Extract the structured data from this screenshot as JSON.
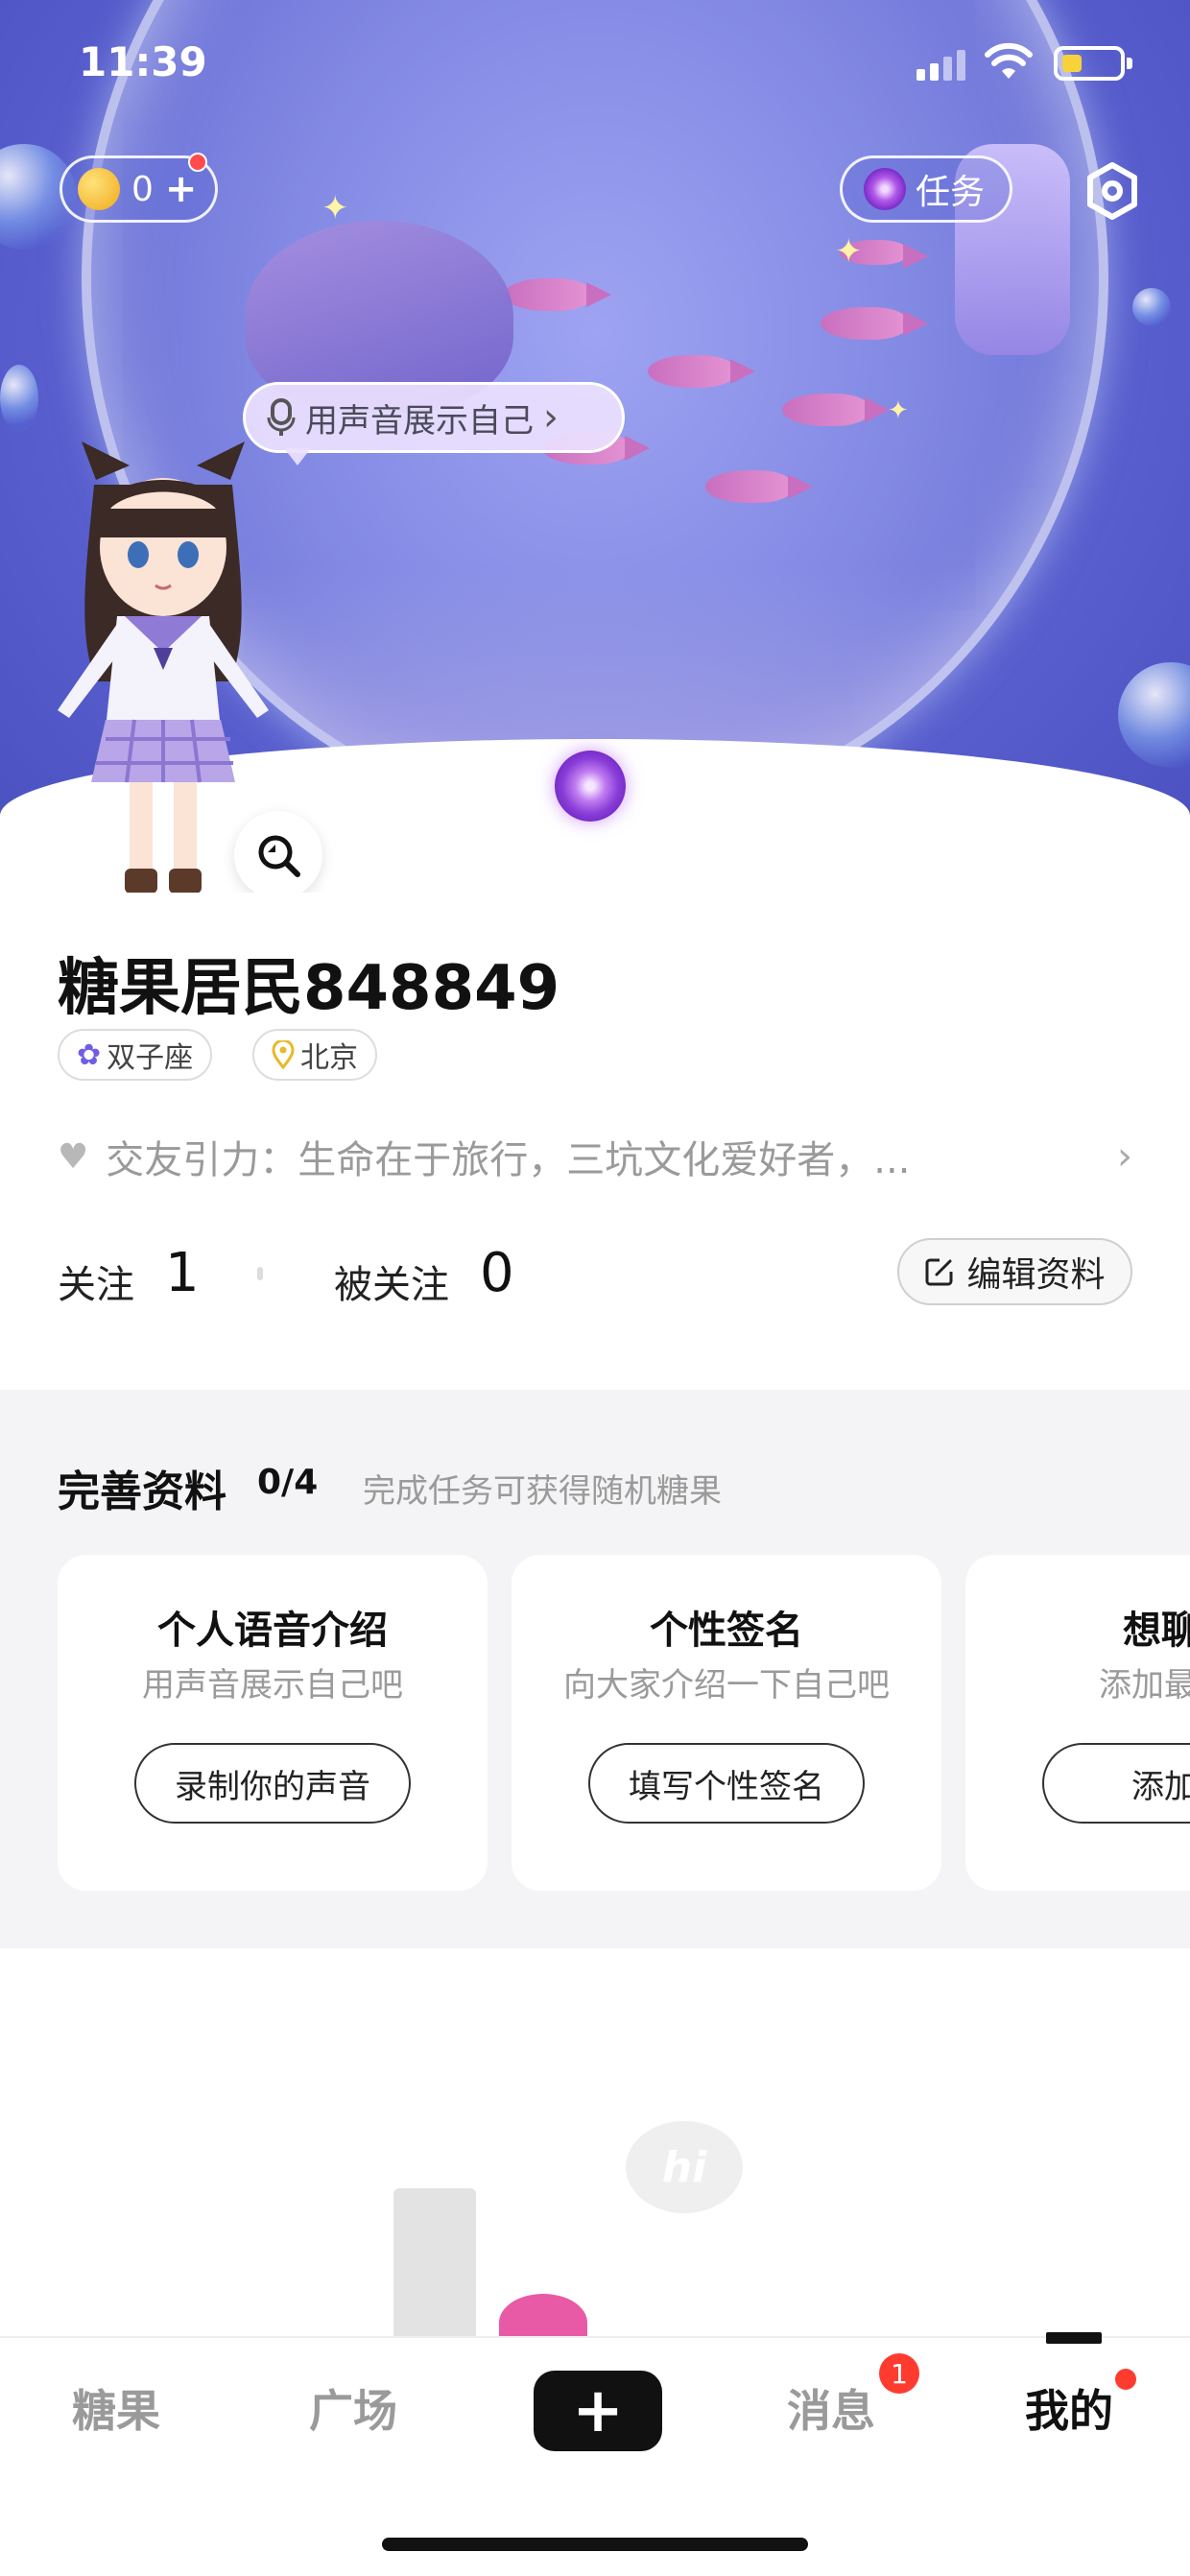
{
  "status_bar": {
    "time": "11:39"
  },
  "header": {
    "coins": "0",
    "coin_plus": "+",
    "task_label": "任务",
    "voice_prompt": "用声音展示自己",
    "voice_chevron": "›"
  },
  "profile": {
    "username": "糖果居民848849",
    "zodiac": "双子座",
    "location": "北京",
    "bio": "交友引力：生命在于旅行，三坑文化爱好者，...",
    "following_label": "关注",
    "following_count": "1",
    "followers_label": "被关注",
    "followers_count": "0",
    "edit_label": "编辑资料"
  },
  "completion": {
    "title": "完善资料",
    "progress": "0/4",
    "hint": "完成任务可获得随机糖果",
    "cards": [
      {
        "title": "个人语音介绍",
        "subtitle": "用声音展示自己吧",
        "button": "录制你的声音"
      },
      {
        "title": "个性签名",
        "subtitle": "向大家介绍一下自己吧",
        "button": "填写个性签名"
      },
      {
        "title": "想聊的",
        "subtitle": "添加最近想",
        "button": "添加话"
      }
    ]
  },
  "illustration": {
    "bubble_text": "hi"
  },
  "tabs": {
    "candy": "糖果",
    "square": "广场",
    "create": "+",
    "messages": "消息",
    "messages_badge": "1",
    "me": "我的"
  },
  "icons": {
    "coin": "coin-icon",
    "task": "candy-swirl-icon",
    "settings": "settings-hexagon-icon",
    "mic": "mic-icon",
    "zodiac": "flower-icon",
    "location": "location-pin-icon",
    "heart": "heart-icon",
    "edit": "edit-icon",
    "zoom": "magnify-icon"
  },
  "colors": {
    "accent": "#111111",
    "badge": "#ff3b30",
    "coin": "#f0a91a",
    "hero": "#6f74d9"
  }
}
